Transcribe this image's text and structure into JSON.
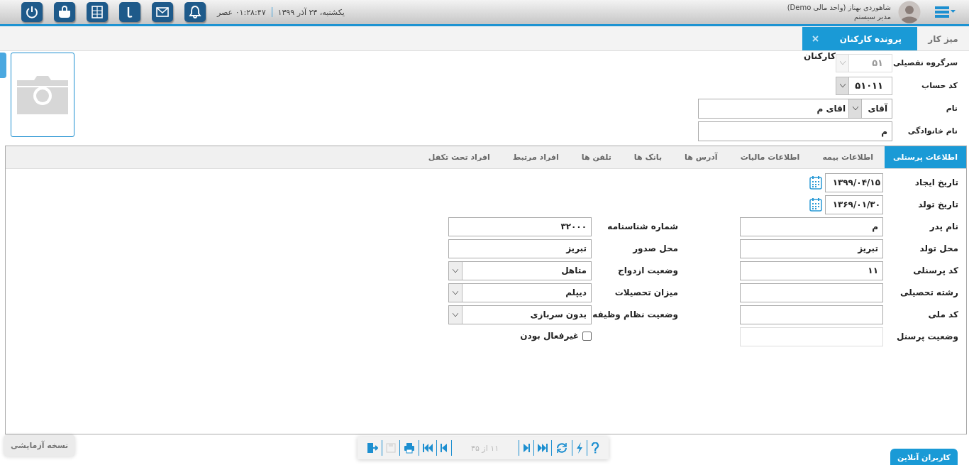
{
  "header": {
    "user_name": "شاهوردی بهناز (واحد مالی Demo)",
    "role": "مدیر سیستم",
    "date": "یکشنبه، ۲۳ آذر ۱۳۹۹",
    "time": "۰۱:۲۸:۴۷ عصر"
  },
  "page_tabs": [
    {
      "label": "میز کار",
      "selected": false,
      "closable": false
    },
    {
      "label": "پرونده کارکنان",
      "selected": true,
      "closable": true
    }
  ],
  "top_form": [
    {
      "label": "سرگروه تفصیلی",
      "kind": "locked-combo",
      "value": "۵۱",
      "note": "کارکنان"
    },
    {
      "label": "کد حساب",
      "kind": "combo",
      "value": "۵۱۰۱۱"
    },
    {
      "label": "نام",
      "kind": "titled-name",
      "title": "آقای",
      "value": "اقای م"
    },
    {
      "label": "نام خانوادگی",
      "kind": "text",
      "value": "م"
    }
  ],
  "detail_tabs": [
    {
      "label": "اطلاعات پرسنلی",
      "selected": true
    },
    {
      "label": "اطلاعات بیمه",
      "selected": false
    },
    {
      "label": "اطلاعات مالیات",
      "selected": false
    },
    {
      "label": "آدرس ها",
      "selected": false
    },
    {
      "label": "بانک ها",
      "selected": false
    },
    {
      "label": "تلفن ها",
      "selected": false
    },
    {
      "label": "افراد مرتبط",
      "selected": false
    },
    {
      "label": "افراد تحت تکفل",
      "selected": false
    }
  ],
  "personal_form": [
    {
      "cells": [
        {
          "label": "تاریخ ایجاد",
          "kind": "date",
          "value": "۱۳۹۹/۰۴/۱۵"
        }
      ]
    },
    {
      "cells": [
        {
          "label": "تاریخ تولد",
          "kind": "date",
          "value": "۱۳۶۹/۰۱/۳۰"
        }
      ]
    },
    {
      "cells": [
        {
          "label": "نام پدر",
          "kind": "text",
          "value": "م"
        },
        {
          "label": "شماره شناسنامه",
          "kind": "text",
          "value": "۳۲۰۰۰"
        }
      ]
    },
    {
      "cells": [
        {
          "label": "محل تولد",
          "kind": "text",
          "value": "تبریز"
        },
        {
          "label": "محل صدور",
          "kind": "text",
          "value": "تبریز"
        }
      ]
    },
    {
      "cells": [
        {
          "label": "کد پرسنلی",
          "kind": "text",
          "value": "۱۱"
        },
        {
          "label": "وضعیت ازدواج",
          "kind": "select",
          "value": "متاهل"
        }
      ]
    },
    {
      "cells": [
        {
          "label": "رشته تحصیلی",
          "kind": "text"
        },
        {
          "label": "میزان تحصیلات",
          "kind": "select",
          "value": "دیپلم"
        }
      ]
    },
    {
      "cells": [
        {
          "label": "کد ملی",
          "kind": "text"
        },
        {
          "label": "وضعیت نظام وظیفه",
          "kind": "select",
          "value": "بدون سربازی"
        }
      ]
    },
    {
      "cells": [
        {
          "label": "وضعیت پرسنل",
          "kind": "readonly"
        },
        {
          "label": "غیرفعال بودن",
          "kind": "checkbox",
          "checked": false
        }
      ]
    }
  ],
  "pager": {
    "position": "۱۱ از ۳۵"
  },
  "trial_badge": "نسخه آزمایشی",
  "online_users_tab": "کاربران آنلاین"
}
